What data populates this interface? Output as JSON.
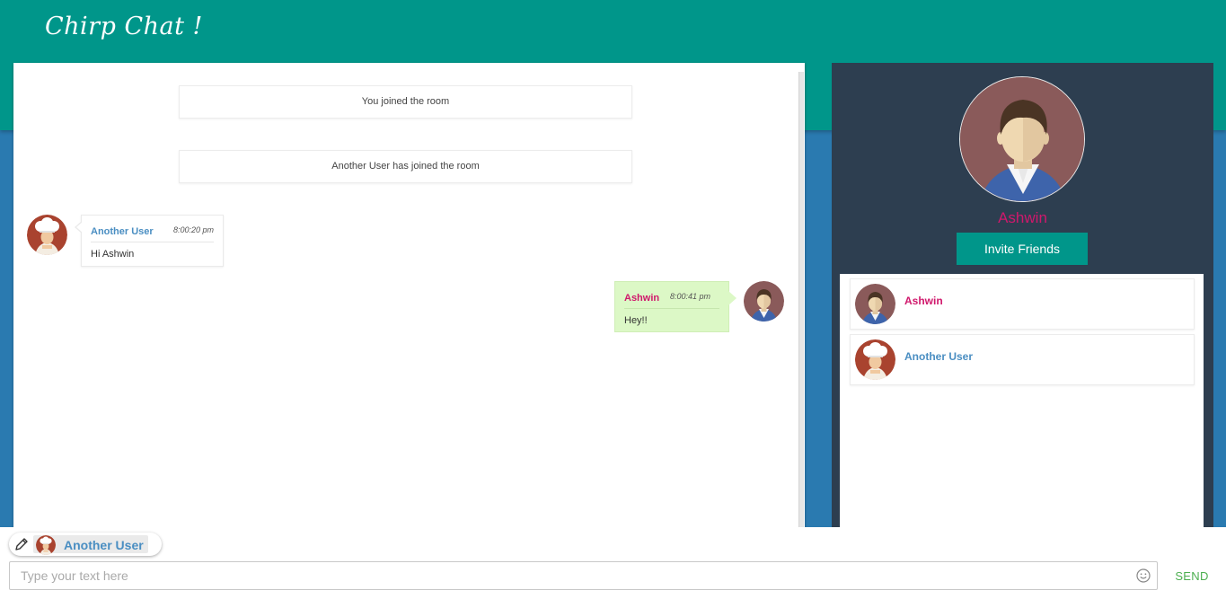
{
  "app": {
    "logo": "Chirp Chat !"
  },
  "colors": {
    "header_teal": "#00968a",
    "page_blue": "#2a7ab0",
    "sidebar_dark": "#2d3e50",
    "self_name": "#d0186c",
    "other_name": "#4a8ec2",
    "outgoing_bubble": "#dcf8c6",
    "send_green": "#4caf50"
  },
  "chat": {
    "system_messages": [
      "You joined the room",
      "Another User has joined the room"
    ],
    "messages": [
      {
        "sender": "Another User",
        "time": "8:00:20 pm",
        "text": "Hi Ashwin",
        "direction": "incoming",
        "avatar": "chef-avatar-icon"
      },
      {
        "sender": "Ashwin",
        "time": "8:00:41 pm",
        "text": "Hey!!",
        "direction": "outgoing",
        "avatar": "man-avatar-icon"
      }
    ]
  },
  "sidebar": {
    "profile_name": "Ashwin",
    "invite_label": "Invite Friends",
    "users": [
      {
        "name": "Ashwin",
        "avatar": "man-avatar-icon"
      },
      {
        "name": "Another User",
        "avatar": "chef-avatar-icon"
      }
    ]
  },
  "composer": {
    "typing_user": "Another User",
    "placeholder": "Type your text here",
    "value": "",
    "send_label": "SEND",
    "icons": [
      "pencil-icon",
      "emoji-icon"
    ]
  }
}
